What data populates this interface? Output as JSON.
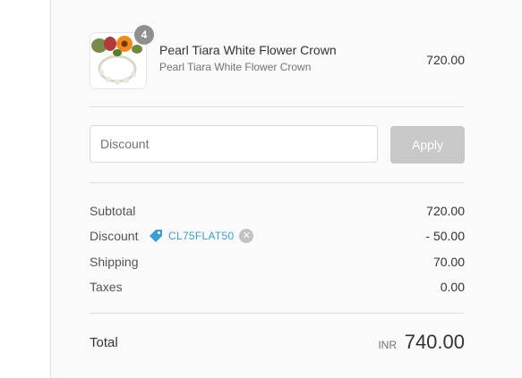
{
  "product": {
    "name": "Pearl Tiara White Flower Crown",
    "variant": "Pearl Tiara White Flower Crown",
    "price": "720.00",
    "quantity": "4",
    "image_icon": "flower-crown-image"
  },
  "discount": {
    "placeholder": "Discount",
    "apply_label": "Apply"
  },
  "totals": {
    "subtotal_label": "Subtotal",
    "subtotal_value": "720.00",
    "discount_label": "Discount",
    "discount_code": "CL75FLAT50",
    "discount_value": "- 50.00",
    "shipping_label": "Shipping",
    "shipping_value": "70.00",
    "taxes_label": "Taxes",
    "taxes_value": "0.00",
    "total_label": "Total",
    "currency": "INR",
    "total_value": "740.00"
  },
  "colors": {
    "accent": "#3a9fcf",
    "button_disabled": "#c8c8c8",
    "badge": "#8f8f8f"
  }
}
